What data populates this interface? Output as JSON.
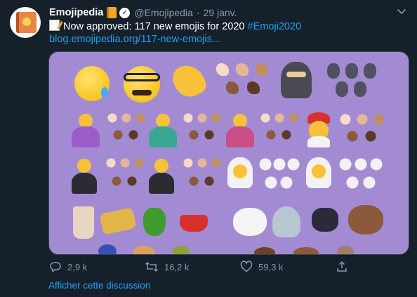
{
  "tweet": {
    "display_name": "Emojipedia",
    "handle": "@Emojipedia",
    "date": "29 janv.",
    "text_prefix": "Now approved: 117 new emojis for 2020",
    "hashtag": "#Emoji2020",
    "link": "blog.emojipedia.org/117-new-emojis...",
    "media_description_icons": [
      "smiling-face-with-tear",
      "disguised-face",
      "pinched-fingers",
      "ninja",
      "person-feeding-baby",
      "person-in-tuxedo",
      "person-with-veil",
      "bubble-tea",
      "tamale",
      "bell-pepper",
      "fondue",
      "polar-bear",
      "seal",
      "black-cat",
      "mammoth"
    ]
  },
  "actions": {
    "reply_count": "2,9 k",
    "retweet_count": "16,2 k",
    "like_count": "59,3 k"
  },
  "show_thread": "Afficher cette discussion",
  "colors": {
    "background": "#15202b",
    "secondary_text": "#8899a6",
    "link": "#1da1f2",
    "media_background": "#a28bd3"
  }
}
